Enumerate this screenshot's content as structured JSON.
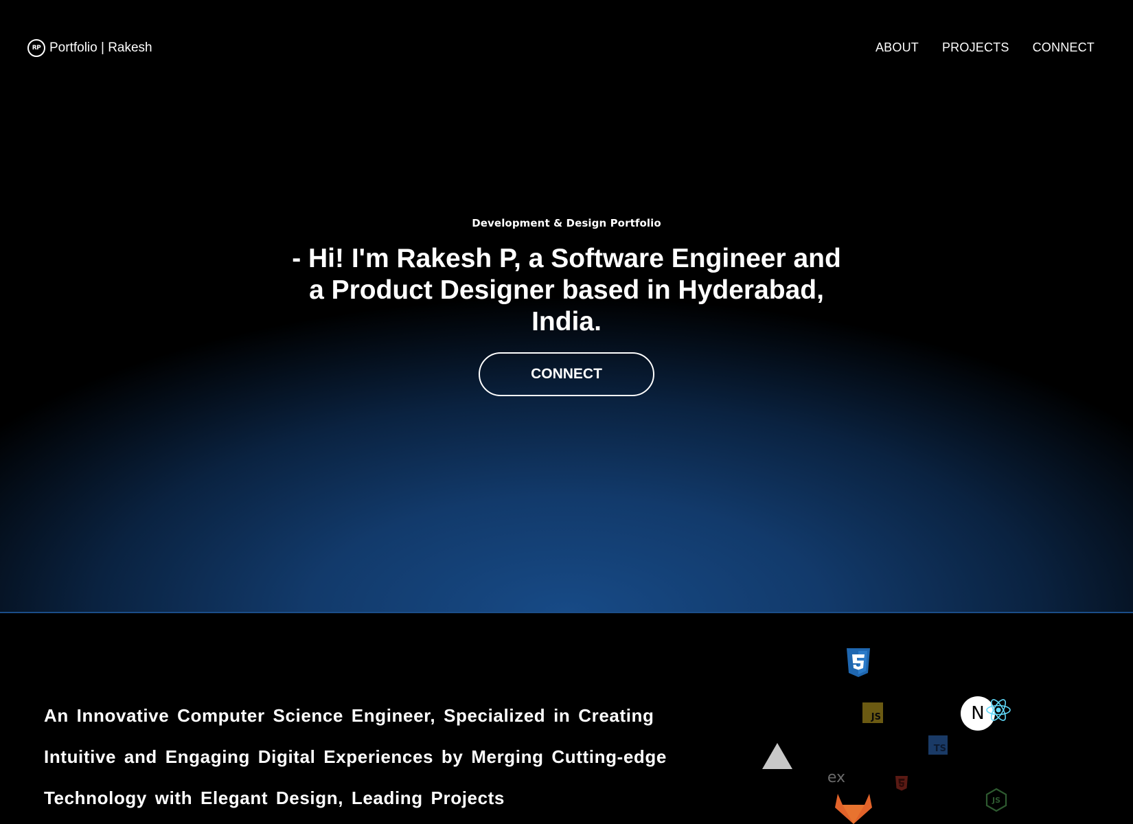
{
  "brand": {
    "logo_text": "RP",
    "name": "Portfolio | Rakesh"
  },
  "nav": {
    "links": [
      "ABOUT",
      "PROJECTS",
      "CONNECT"
    ]
  },
  "hero": {
    "eyebrow": "Development & Design Portfolio",
    "title": "- Hi! I'm Rakesh P, a Software Engineer and a Product Designer based in Hyderabad, India.",
    "cta_label": "CONNECT"
  },
  "intro": {
    "text": "An Innovative Computer Science Engineer, Specialized in Creating Intuitive and Engaging Digital Experiences by Merging Cutting-edge Technology with Elegant Design, Leading Projects"
  },
  "tech_icons": [
    {
      "name": "css3-icon"
    },
    {
      "name": "javascript-icon",
      "label": "JS"
    },
    {
      "name": "nextjs-icon",
      "label": "N"
    },
    {
      "name": "react-icon"
    },
    {
      "name": "typescript-icon",
      "label": "TS"
    },
    {
      "name": "vercel-icon"
    },
    {
      "name": "express-icon",
      "label": "ex"
    },
    {
      "name": "html5-icon",
      "label": "5"
    },
    {
      "name": "nodejs-icon",
      "label": "JS"
    },
    {
      "name": "gitlab-icon"
    }
  ],
  "colors": {
    "background": "#000000",
    "hero_glow": "#174a86",
    "text": "#ffffff",
    "css3": "#1f67b0",
    "javascript": "#6b5a12",
    "react": "#61dafb",
    "typescript": "#1a3a66",
    "html5": "#5a1a14",
    "nodejs": "#2e5a30",
    "gitlab": "#e2632a"
  }
}
